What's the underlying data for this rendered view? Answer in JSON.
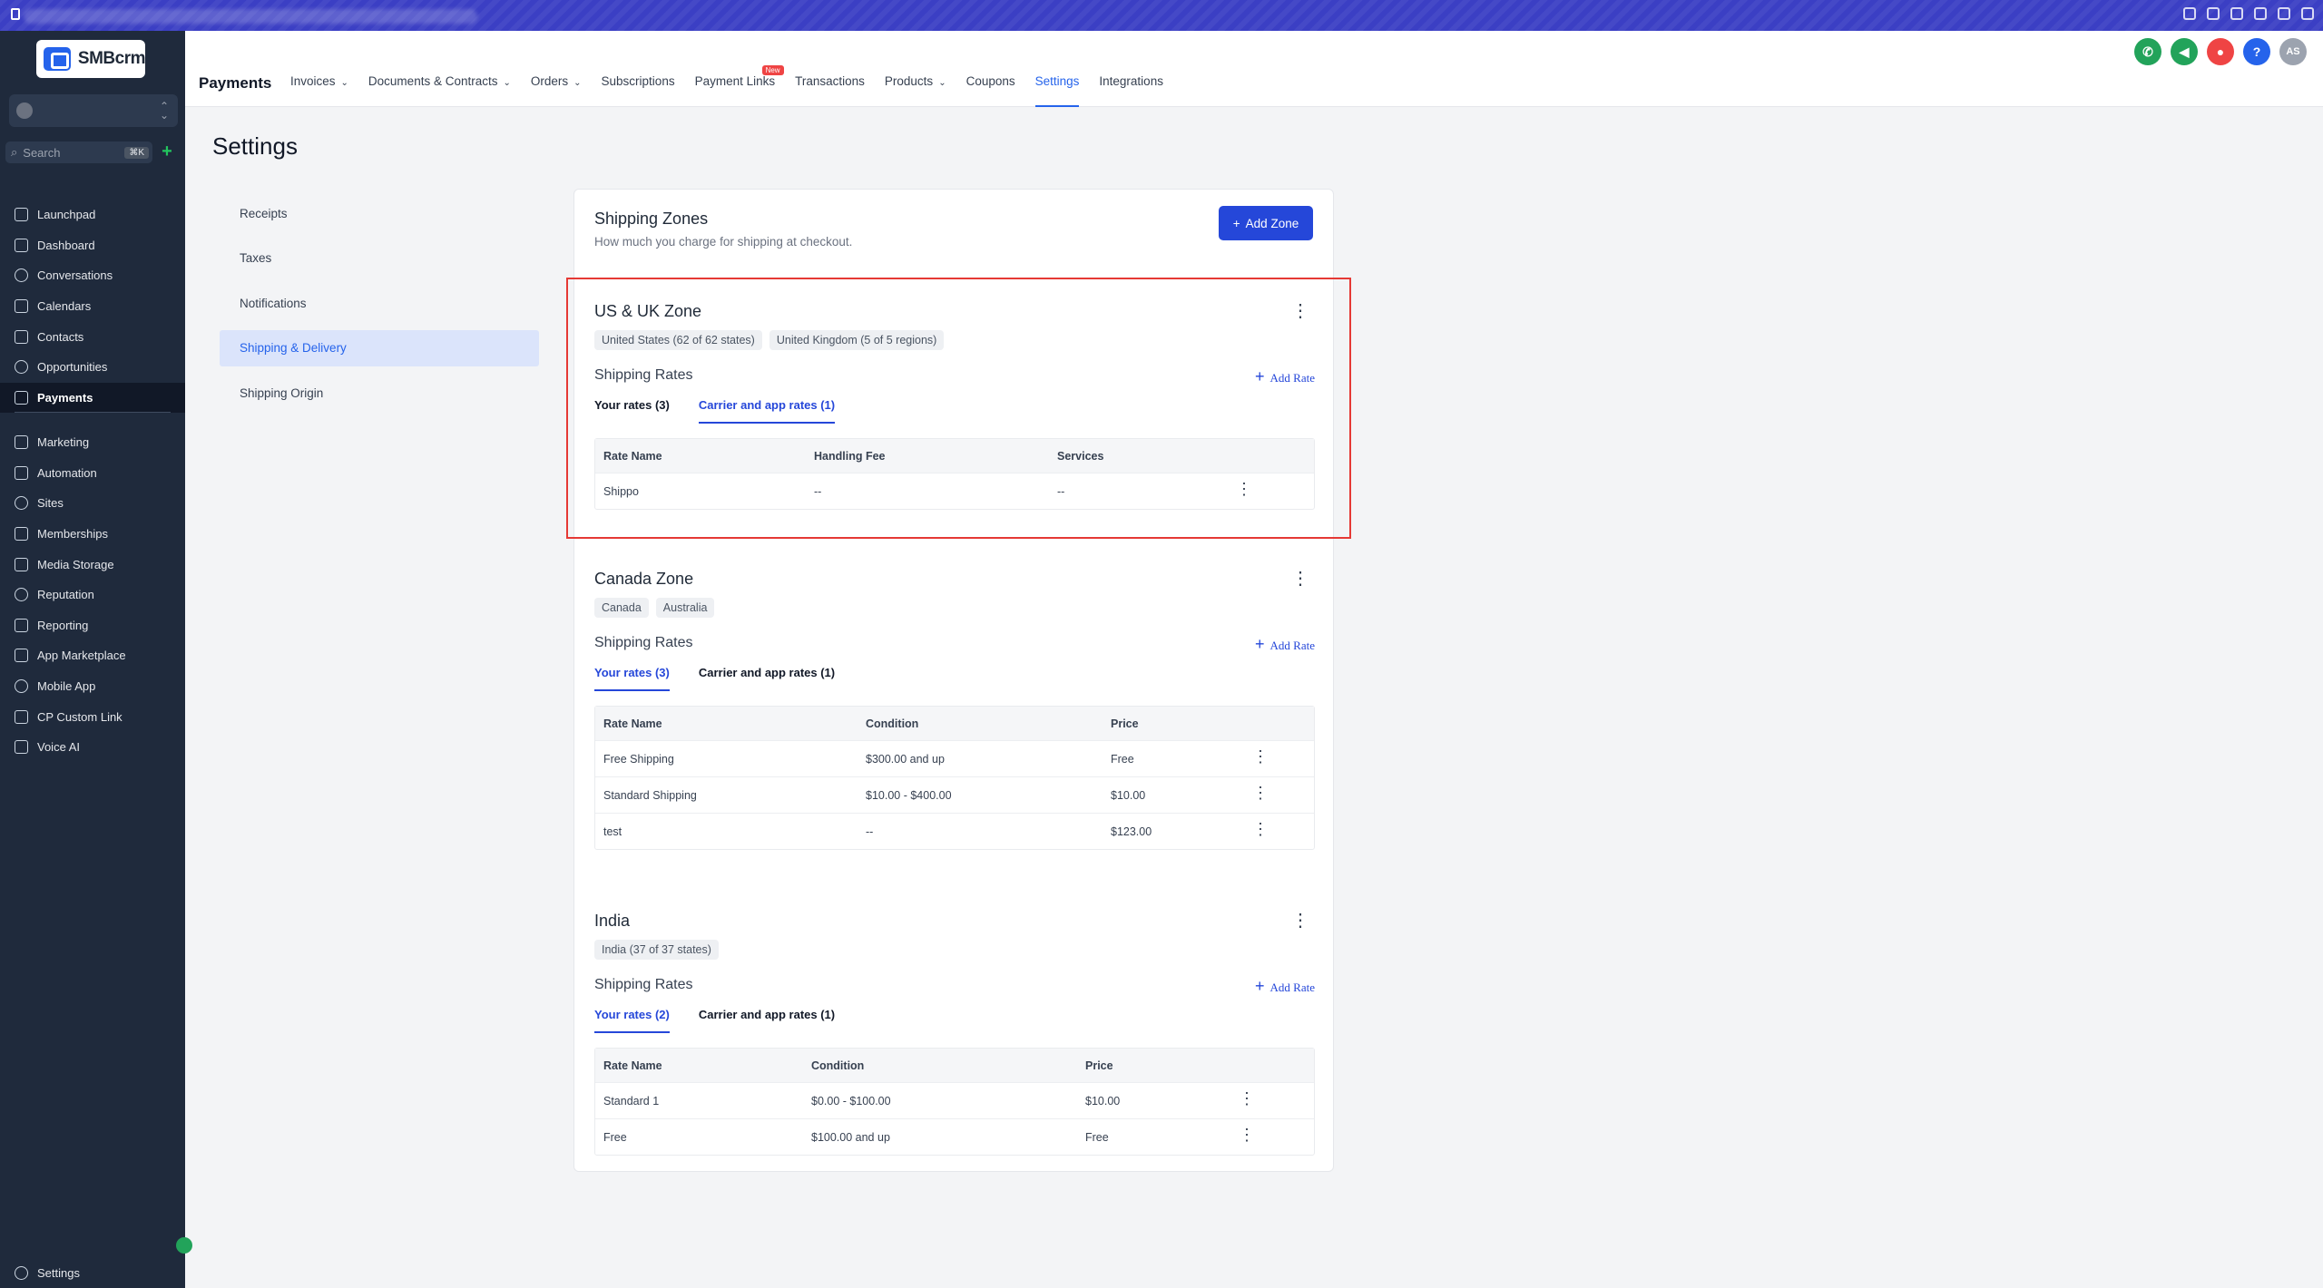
{
  "sidebar": {
    "logo_text": "SMBcrm",
    "search_placeholder": "Search",
    "search_shortcut": "⌘K",
    "nav_top": [
      {
        "label": "Launchpad",
        "icon": "launchpad-icon"
      },
      {
        "label": "Dashboard",
        "icon": "dashboard-icon"
      },
      {
        "label": "Conversations",
        "icon": "chat-icon"
      },
      {
        "label": "Calendars",
        "icon": "calendar-icon"
      },
      {
        "label": "Contacts",
        "icon": "contacts-icon"
      },
      {
        "label": "Opportunities",
        "icon": "opportunities-icon"
      },
      {
        "label": "Payments",
        "icon": "payments-icon"
      }
    ],
    "nav_bottom": [
      {
        "label": "Marketing",
        "icon": "send-icon"
      },
      {
        "label": "Automation",
        "icon": "automation-icon"
      },
      {
        "label": "Sites",
        "icon": "sites-icon"
      },
      {
        "label": "Memberships",
        "icon": "memberships-icon"
      },
      {
        "label": "Media Storage",
        "icon": "media-icon"
      },
      {
        "label": "Reputation",
        "icon": "star-icon"
      },
      {
        "label": "Reporting",
        "icon": "reporting-icon"
      },
      {
        "label": "App Marketplace",
        "icon": "grid-icon"
      },
      {
        "label": "Mobile App",
        "icon": "mobile-icon"
      },
      {
        "label": "CP Custom Link",
        "icon": "link-icon"
      },
      {
        "label": "Voice AI",
        "icon": "voice-icon"
      }
    ],
    "settings_label": "Settings"
  },
  "topnav": {
    "title": "Payments",
    "tabs": [
      {
        "label": "Invoices",
        "caret": true
      },
      {
        "label": "Documents & Contracts",
        "caret": true
      },
      {
        "label": "Orders",
        "caret": true
      },
      {
        "label": "Subscriptions"
      },
      {
        "label": "Payment Links",
        "badge": "New"
      },
      {
        "label": "Transactions"
      },
      {
        "label": "Products",
        "caret": true
      },
      {
        "label": "Coupons"
      },
      {
        "label": "Settings",
        "active": true
      },
      {
        "label": "Integrations"
      }
    ],
    "avatar_initials": "AS"
  },
  "page": {
    "title": "Settings",
    "subnav": [
      "Receipts",
      "Taxes",
      "Notifications",
      "Shipping & Delivery",
      "Shipping Origin"
    ],
    "active_subnav": "Shipping & Delivery"
  },
  "card": {
    "title": "Shipping Zones",
    "subtitle": "How much you charge for shipping at checkout.",
    "add_zone_label": "Add Zone",
    "shipping_rates_label": "Shipping Rates",
    "add_rate_label": "Add Rate",
    "zones": [
      {
        "name": "US & UK Zone",
        "chips": [
          "United States (62 of 62 states)",
          "United Kingdom (5 of 5 regions)"
        ],
        "tab_your": "Your rates (3)",
        "tab_carrier": "Carrier and app rates (1)",
        "active_tab": "carrier",
        "columns": [
          "Rate Name",
          "Handling Fee",
          "Services"
        ],
        "rows": [
          [
            "Shippo",
            "--",
            "--"
          ]
        ]
      },
      {
        "name": "Canada Zone",
        "chips": [
          "Canada",
          "Australia"
        ],
        "tab_your": "Your rates (3)",
        "tab_carrier": "Carrier and app rates (1)",
        "active_tab": "your",
        "columns": [
          "Rate Name",
          "Condition",
          "Price"
        ],
        "rows": [
          [
            "Free Shipping",
            "$300.00 and up",
            "Free"
          ],
          [
            "Standard Shipping",
            "$10.00 - $400.00",
            "$10.00"
          ],
          [
            "test",
            "--",
            "$123.00"
          ]
        ]
      },
      {
        "name": "India",
        "chips": [
          "India (37 of 37 states)"
        ],
        "tab_your": "Your rates (2)",
        "tab_carrier": "Carrier and app rates (1)",
        "active_tab": "your",
        "columns": [
          "Rate Name",
          "Condition",
          "Price"
        ],
        "rows": [
          [
            "Standard 1",
            "$0.00 - $100.00",
            "$10.00"
          ],
          [
            "Free",
            "$100.00 and up",
            "Free"
          ]
        ]
      }
    ]
  },
  "colors": {
    "accent": "#2547d9",
    "sidebar_bg": "#1f2a3c",
    "highlight_border": "#e53935"
  }
}
